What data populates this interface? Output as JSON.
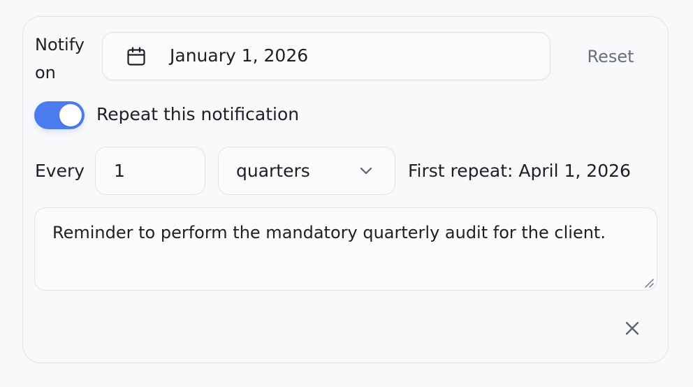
{
  "notify": {
    "label": "Notify on",
    "date_value": "January 1, 2026",
    "calendar_icon": "calendar-icon",
    "reset_label": "Reset"
  },
  "repeat": {
    "toggle_on": true,
    "label": "Repeat this notification",
    "accent_color": "#4a7cf0"
  },
  "interval": {
    "every_label": "Every",
    "count_value": "1",
    "unit_value": "quarters",
    "unit_chevron_icon": "chevron-down-icon",
    "first_repeat_text": "First repeat: April 1, 2026"
  },
  "message": {
    "value": "Reminder to perform the mandatory quarterly audit for the client."
  },
  "close": {
    "icon": "close-icon"
  }
}
